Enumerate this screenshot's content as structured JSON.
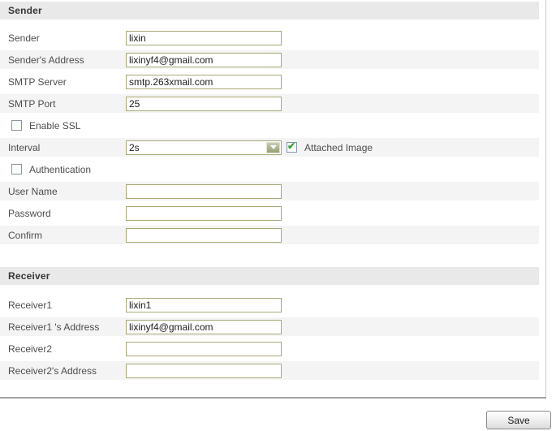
{
  "sender_section": {
    "title": "Sender",
    "sender": {
      "label": "Sender",
      "value": "lixin"
    },
    "sender_address": {
      "label": "Sender's Address",
      "value": "lixinyf4@gmail.com"
    },
    "smtp_server": {
      "label": "SMTP Server",
      "value": "smtp.263xmail.com"
    },
    "smtp_port": {
      "label": "SMTP Port",
      "value": "25"
    },
    "enable_ssl": {
      "label": "Enable SSL",
      "checked": false
    },
    "interval": {
      "label": "Interval",
      "selected": "2s"
    },
    "attached_image": {
      "label": "Attached Image",
      "checked": true
    },
    "authentication": {
      "label": "Authentication",
      "checked": false
    },
    "user_name": {
      "label": "User Name",
      "value": ""
    },
    "password": {
      "label": "Password",
      "value": ""
    },
    "confirm": {
      "label": "Confirm",
      "value": ""
    }
  },
  "receiver_section": {
    "title": "Receiver",
    "receiver1": {
      "label": "Receiver1",
      "value": "lixin1"
    },
    "receiver1_address": {
      "label": "Receiver1 's Address",
      "value": "lixinyf4@gmail.com"
    },
    "receiver2": {
      "label": "Receiver2",
      "value": ""
    },
    "receiver2_address": {
      "label": "Receiver2's Address",
      "value": ""
    }
  },
  "footer": {
    "save_label": "Save"
  },
  "colors": {
    "input_border": "#a9a877",
    "row_stripe": "#f4f4f4",
    "section_header_bg": "#e9e9e9",
    "check_green": "#2fa12f",
    "dropdown_button_green": "#9aa37c",
    "panel_border": "#a3a3a3"
  }
}
